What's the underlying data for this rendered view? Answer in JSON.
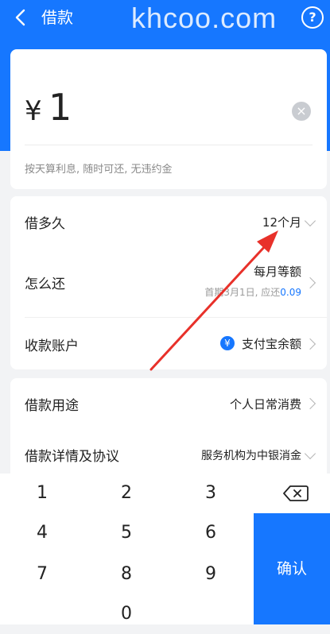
{
  "header": {
    "back_icon": "chevron-left-icon",
    "title": "借款",
    "watermark": "khcoo.com",
    "help_icon": "question-icon",
    "help_symbol": "?",
    "bg_color": "#1677ff"
  },
  "amount": {
    "currency": "¥",
    "value": "1",
    "clear_icon": "clear-icon",
    "clear_symbol": "×",
    "hint": "按天算利息, 随时可还, 无违约金"
  },
  "terms": {
    "duration_label": "借多久",
    "duration_value": "12个月",
    "repay_label": "怎么还",
    "repay_value": "每月等额",
    "repay_sub_prefix": "首期3月1日, 应还",
    "repay_sub_amount": "0.09",
    "account_label": "收款账户",
    "account_icon_symbol": "¥",
    "account_value": "支付宝余额"
  },
  "more": {
    "purpose_label": "借款用途",
    "purpose_value": "个人日常消费",
    "details_label": "借款详情及协议",
    "details_value": "服务机构为中银消金"
  },
  "keypad": {
    "k1": "1",
    "k2": "2",
    "k3": "3",
    "k4": "4",
    "k5": "5",
    "k6": "6",
    "k7": "7",
    "k8": "8",
    "k9": "9",
    "k0": "0",
    "delete_icon": "backspace-icon",
    "confirm": "确认"
  },
  "annotation": {
    "color": "#e8312a"
  },
  "accent_color": "#1677ff"
}
